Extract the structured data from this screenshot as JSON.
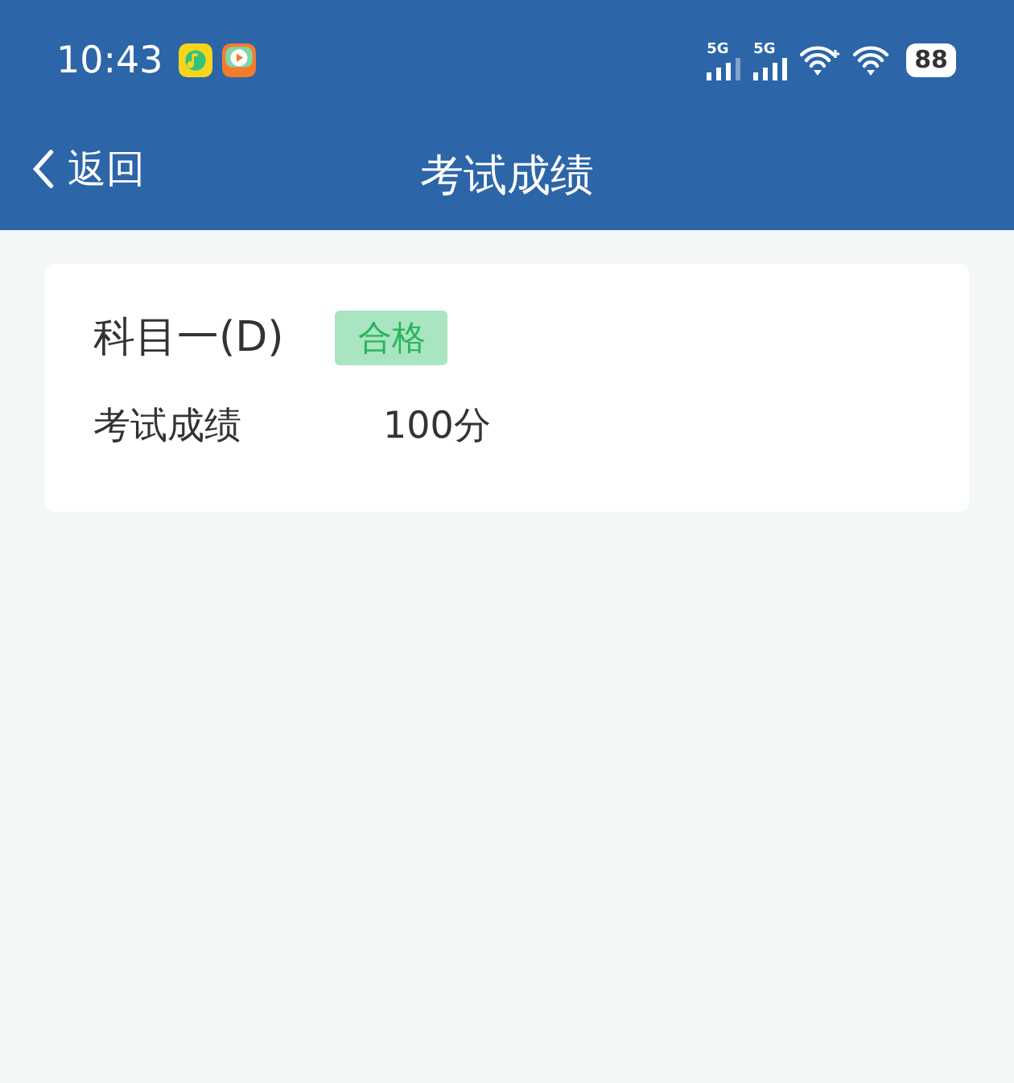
{
  "status_bar": {
    "time": "10:43",
    "signal_labels": [
      "5G",
      "5G"
    ],
    "battery": "88"
  },
  "nav_bar": {
    "back_label": "返回",
    "title": "考试成绩"
  },
  "results": [
    {
      "subject": "科目一(D)",
      "badge": {
        "text": "合格",
        "kind": "pass"
      },
      "score_label": "考试成绩",
      "score": "100分"
    }
  ]
}
